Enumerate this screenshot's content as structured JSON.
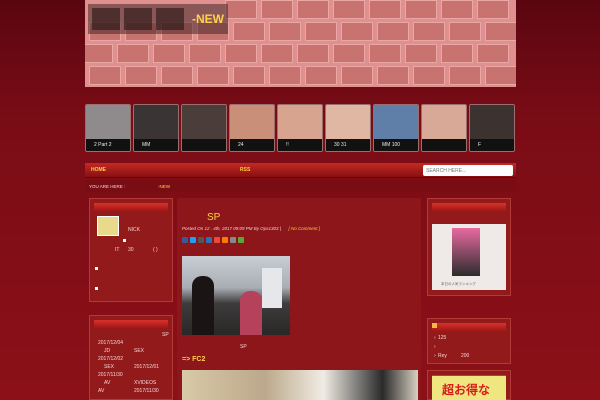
{
  "header": {
    "title_suffix": "-NEW"
  },
  "thumbnails": [
    {
      "label": "2",
      "label2": "Part 2",
      "color": "#8f8a8c"
    },
    {
      "label": "MM",
      "label2": "",
      "color": "#3a3534"
    },
    {
      "label": "",
      "label2": "",
      "color": "#4a3d3a"
    },
    {
      "label": "24",
      "label2": "",
      "color": "#c98f78"
    },
    {
      "label": "!!",
      "label2": "",
      "color": "#d7a48f"
    },
    {
      "label": "30",
      "label2": "31",
      "color": "#e0b7a3"
    },
    {
      "label": "MM",
      "label2": "100",
      "color": "#5f7fa8"
    },
    {
      "label": "",
      "label2": "",
      "color": "#d8a996"
    },
    {
      "label": "F",
      "label2": "",
      "color": "#3c3230"
    }
  ],
  "nav": {
    "home": "HOME",
    "rss": "RSS",
    "search_placeholder": "SEARCH HERE..."
  },
  "breadcrumb": {
    "prefix": "YOU ARE HERE :",
    "current": "-NEW"
  },
  "profile": {
    "name": "NICK",
    "line1": "IT",
    "line1_num": "30",
    "line1_paren": "(    )"
  },
  "recent": {
    "items": [
      {
        "a": "",
        "b": "SP"
      },
      {
        "a": "2017/12/04",
        "b": ""
      },
      {
        "a": "JD",
        "b": "SEX"
      },
      {
        "a": "2017/12/02",
        "b": ""
      },
      {
        "a": "SEX",
        "b": "2017/12/01"
      },
      {
        "a": "2017/11/30",
        "b": ""
      },
      {
        "a": "AV",
        "b": "XVIDEOS"
      },
      {
        "a": "AV",
        "b": "2017/11/30"
      }
    ]
  },
  "post": {
    "title": "SP",
    "meta_prefix": "Posted On 12 . 4th, 2017 09:09 PM By Ops1303 |",
    "meta_link": "[ No Comment ]",
    "video_caption": "SP",
    "fc2": "=> FC2",
    "share_colors": [
      "#3b5998",
      "#1da1f2",
      "#555555",
      "#2f6fb7",
      "#e84c3d",
      "#ff7a00",
      "#888888",
      "#55aa33"
    ]
  },
  "rank": {
    "items": [
      {
        "a": "",
        "b": "125"
      },
      {
        "a": "",
        "b": ""
      },
      {
        "a": "Rey",
        "b": "200"
      }
    ]
  },
  "book_caption": "本日の人気ランキング",
  "ad_text": "超お得な"
}
